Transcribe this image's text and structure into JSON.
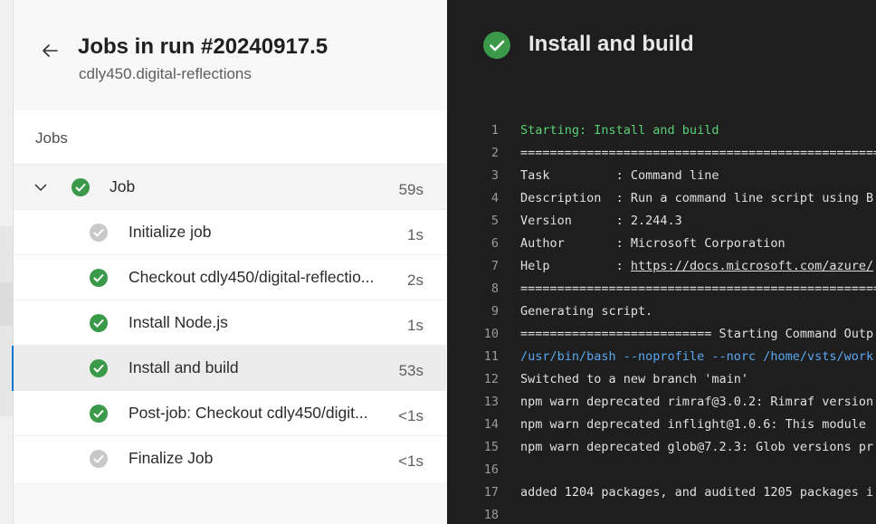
{
  "header": {
    "title": "Jobs in run #20240917.5",
    "subtitle": "cdly450.digital-reflections"
  },
  "jobs": {
    "heading": "Jobs",
    "group": {
      "label": "Job",
      "duration": "59s",
      "status": "success",
      "expanded": true
    },
    "steps": [
      {
        "label": "Initialize job",
        "duration": "1s",
        "status": "skipped",
        "selected": false
      },
      {
        "label": "Checkout cdly450/digital-reflectio...",
        "duration": "2s",
        "status": "success",
        "selected": false
      },
      {
        "label": "Install Node.js",
        "duration": "1s",
        "status": "success",
        "selected": false
      },
      {
        "label": "Install and build",
        "duration": "53s",
        "status": "success",
        "selected": true
      },
      {
        "label": "Post-job: Checkout cdly450/digit...",
        "duration": "<1s",
        "status": "success",
        "selected": false
      },
      {
        "label": "Finalize Job",
        "duration": "<1s",
        "status": "skipped",
        "selected": false
      }
    ]
  },
  "log": {
    "title": "Install and build",
    "status": "success",
    "lines": [
      {
        "n": "1",
        "text": "Starting: Install and build",
        "style": "green"
      },
      {
        "n": "2",
        "text": "==============================================================",
        "style": ""
      },
      {
        "n": "3",
        "text": "Task         : Command line",
        "style": ""
      },
      {
        "n": "4",
        "text": "Description  : Run a command line script using B",
        "style": ""
      },
      {
        "n": "5",
        "text": "Version      : 2.244.3",
        "style": ""
      },
      {
        "n": "6",
        "text": "Author       : Microsoft Corporation",
        "style": ""
      },
      {
        "n": "7",
        "text": "Help         : ",
        "link": "https://docs.microsoft.com/azure/",
        "style": ""
      },
      {
        "n": "8",
        "text": "==============================================================",
        "style": ""
      },
      {
        "n": "9",
        "text": "Generating script.",
        "style": ""
      },
      {
        "n": "10",
        "text": "========================== Starting Command Outp",
        "style": ""
      },
      {
        "n": "11",
        "text": "/usr/bin/bash --noprofile --norc /home/vsts/work",
        "style": "blue"
      },
      {
        "n": "12",
        "text": "Switched to a new branch 'main'",
        "style": ""
      },
      {
        "n": "13",
        "text": "npm warn deprecated rimraf@3.0.2: Rimraf version",
        "style": ""
      },
      {
        "n": "14",
        "text": "npm warn deprecated inflight@1.0.6: This module",
        "style": ""
      },
      {
        "n": "15",
        "text": "npm warn deprecated glob@7.2.3: Glob versions pr",
        "style": ""
      },
      {
        "n": "16",
        "text": "",
        "style": ""
      },
      {
        "n": "17",
        "text": "added 1204 packages, and audited 1205 packages i",
        "style": ""
      },
      {
        "n": "18",
        "text": "",
        "style": ""
      }
    ]
  },
  "colors": {
    "success": "#3a9a4a",
    "skipped": "#c8c8c8",
    "accent": "#0078d4"
  }
}
